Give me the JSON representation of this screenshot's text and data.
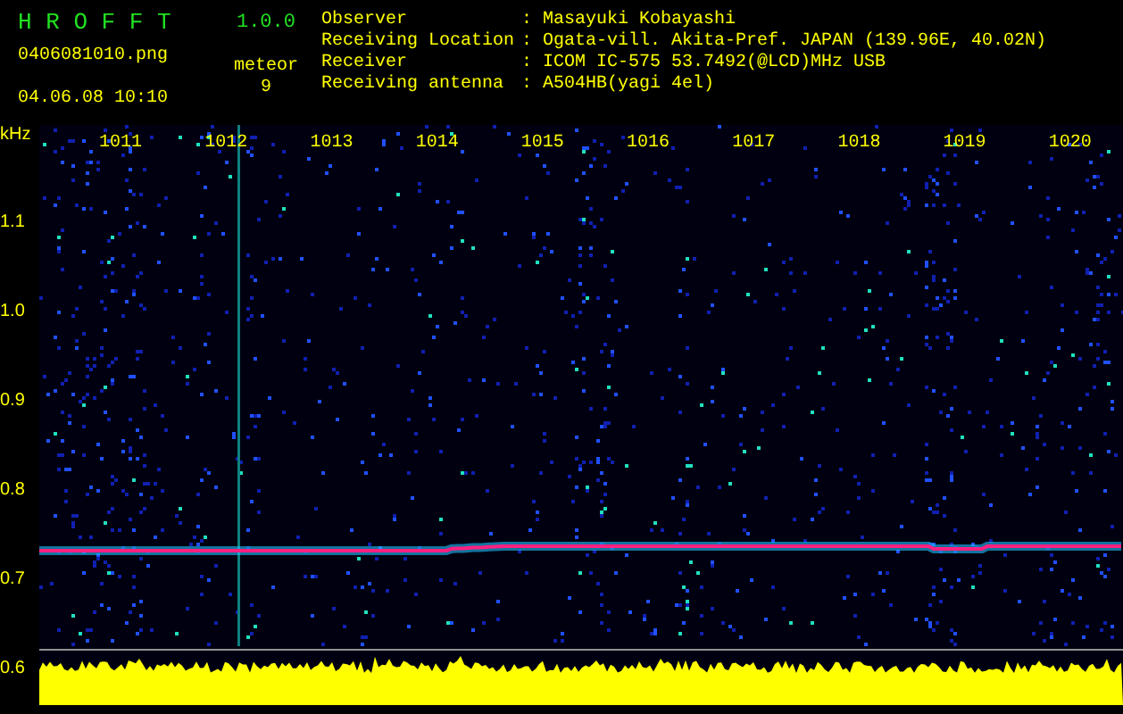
{
  "app": {
    "name": "H R O F F T",
    "version": "1.0.0"
  },
  "file": {
    "name": "0406081010.png",
    "datetime": "04.06.08 10:10"
  },
  "meteor": {
    "label": "meteor",
    "count": "9"
  },
  "info": [
    {
      "label": "Observer",
      "separator": ":",
      "value": "Masayuki Kobayashi"
    },
    {
      "label": "Receiving Location",
      "separator": ":",
      "value": "Ogata-vill. Akita-Pref. JAPAN (139.96E, 40.02N)"
    },
    {
      "label": "Receiver",
      "separator": ":",
      "value": "ICOM IC-575 53.7492(@LCD)MHz USB"
    },
    {
      "label": "Receiving antenna",
      "separator": ":",
      "value": "A504HB(yagi 4el)"
    }
  ],
  "spectrogram": {
    "y_unit": "kHz",
    "y_labels": [
      "1.1",
      "1.0",
      "0.9",
      "0.8",
      "0.7",
      "0.6"
    ],
    "x_labels": [
      "1011",
      "1012",
      "1013",
      "1014",
      "1015",
      "1016",
      "1017",
      "1018",
      "1019",
      "1020"
    ]
  }
}
